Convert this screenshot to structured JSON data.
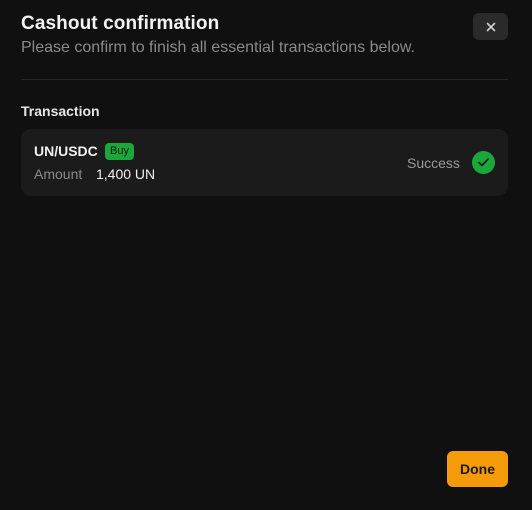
{
  "header": {
    "title": "Cashout confirmation",
    "subtitle": "Please confirm to finish all essential transactions below.",
    "close_icon": "close-icon"
  },
  "section": {
    "label": "Transaction"
  },
  "transaction": {
    "pair": "UN/USDC",
    "side_badge": "Buy",
    "amount_label": "Amount",
    "amount_value": "1,400 UN",
    "status": "Success",
    "status_icon": "check-circle-icon"
  },
  "footer": {
    "done_label": "Done"
  },
  "colors": {
    "accent": "#f59b0a",
    "success": "#1aa83a",
    "background": "#101010",
    "card": "#1b1b1b"
  }
}
